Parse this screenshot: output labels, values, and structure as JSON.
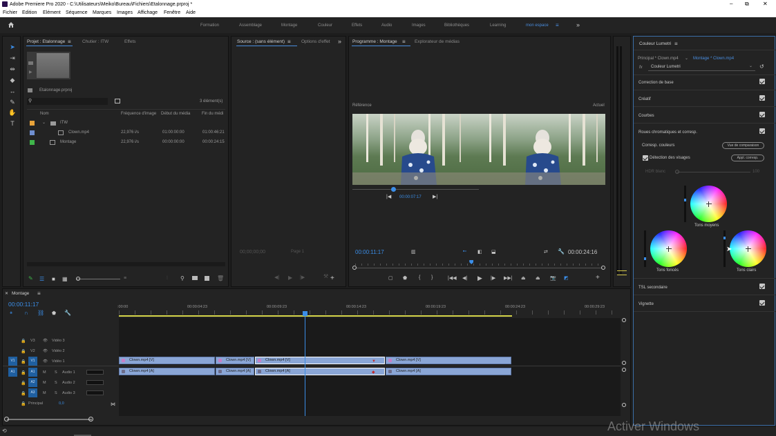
{
  "window": {
    "title": "Adobe Premiere Pro 2020 - C:\\Utilisateurs\\Meiko\\Bureau\\Fichiers\\Etalonnage.prproj *",
    "controls": {
      "minimize": "–",
      "maximize": "⧉",
      "close": "✕"
    }
  },
  "menu": [
    "Fichier",
    "Edition",
    "Elément",
    "Séquence",
    "Marques",
    "Images",
    "Affichage",
    "Fenêtre",
    "Aide"
  ],
  "workspaces": {
    "items": [
      "Formation",
      "Assemblage",
      "Montage",
      "Couleur",
      "Effets",
      "Audio",
      "Images",
      "Bibliothèques",
      "Learning",
      "mon espace"
    ],
    "active": "mon espace",
    "menu_glyph": "≡",
    "more_glyph": "»"
  },
  "project": {
    "tabs": [
      "Projet : Etalonnage",
      "Chutier : ITW",
      "Effets"
    ],
    "menu_glyph": "≡",
    "file_name": "Etalonnage.prproj",
    "count": "3 élément(s)",
    "columns": [
      "Nom",
      "Fréquence d'image",
      "Début du média",
      "Fin du médi"
    ],
    "rows": [
      {
        "name": "ITW",
        "fps": "",
        "start": "",
        "end": "",
        "color": "#e8a33a",
        "kind": "folder"
      },
      {
        "name": "Clown.mp4",
        "fps": "22,976 i/s",
        "start": "01:00:00:00",
        "end": "01:00:46:21",
        "color": "#6f8fd0",
        "kind": "clip"
      },
      {
        "name": "Montage",
        "fps": "22,976 i/s",
        "start": "00:00:00:00",
        "end": "00:00:24:15",
        "color": "#3fb54a",
        "kind": "sequence"
      }
    ]
  },
  "source": {
    "tabs": [
      "Source : (sans élément)",
      "Options d'effet"
    ],
    "menu_glyph": "≡",
    "more_glyph": "»",
    "timecode": "00;00;00;00",
    "page": "Page 1"
  },
  "program": {
    "tabs": [
      "Programme : Montage",
      "Explorateur de médias"
    ],
    "menu_glyph": "≡",
    "ref_label": "Référence",
    "actual_label": "Actuel",
    "ref_timecode": "00:00:07:17",
    "timecode": "00:00:11:17",
    "duration": "00:00:24:16",
    "ref_playhead": 0.32,
    "playhead": 0.47
  },
  "lumetri": {
    "title": "Couleur Lumetri",
    "menu_glyph": "≡",
    "master": "Principal * Clown.mp4",
    "sequence": "Montage * Clown.mp4",
    "fx_label": "fx",
    "effect": "Couleur Lumetri",
    "sections_top": [
      "Correction de base",
      "Créatif",
      "Courbes",
      "Roues chromatiques et corresp."
    ],
    "match_label": "Corresp. couleurs",
    "compare_btn": "Vue de comparaison",
    "faces_label": "Détection des visages",
    "apply_btn": "Appl. corresp.",
    "hdr_label": "HDR blanc",
    "hdr_value": "100",
    "wheels": [
      "Tons moyens",
      "Tons foncés",
      "Tons clairs"
    ],
    "sections_bottom": [
      "TSL secondaire",
      "Vignette"
    ]
  },
  "timeline": {
    "name": "Montage",
    "menu_glyph": "≡",
    "close_glyph": "✕",
    "timecode": "00:00:11:17",
    "ruler": [
      ":00:00",
      "00:00:04:23",
      "00:00:09:23",
      "00:00:14:23",
      "00:00:19:23",
      "00:00:24:23",
      "00:00:29:23"
    ],
    "video_tracks": [
      {
        "lock": "🔒",
        "tag": "V3",
        "name": "Vidéo 3"
      },
      {
        "lock": "🔒",
        "tag": "V2",
        "name": "Vidéo 2"
      },
      {
        "lock": "🔒",
        "tag": "V1",
        "name": "Vidéo 1",
        "src": "V1"
      }
    ],
    "audio_tracks": [
      {
        "tag": "A1",
        "name": "Audio 1",
        "src": "A1"
      },
      {
        "tag": "A2",
        "name": "Audio 2"
      },
      {
        "tag": "A3",
        "name": "Audio 3"
      }
    ],
    "mute_glyph": "M",
    "solo_glyph": "S",
    "master_label": "Principal",
    "master_value": "0,0",
    "video_clips": [
      "Clown.mp4 [V]",
      "Clown.mp4 [V]",
      "Clown.mp4 [V]",
      "Clown.mp4 [V]"
    ],
    "audio_clips": [
      "Clown.mp4 [A]",
      "Clown.mp4 [A]",
      "Clown.mp4 [A]",
      "Clown.mp4 [A]"
    ]
  },
  "watermark": "Activer Windows",
  "colors": {
    "accent": "#3b8ee8",
    "panel": "#232323",
    "background": "#1d1d1d"
  }
}
